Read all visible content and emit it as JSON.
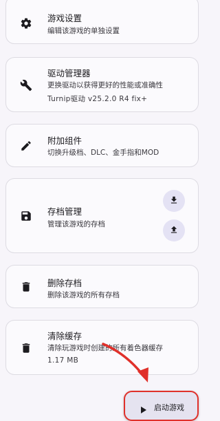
{
  "cards": {
    "game_settings": {
      "title": "游戏设置",
      "subtitle": "编辑该游戏的单独设置",
      "icon": "gear-icon"
    },
    "driver_manager": {
      "title": "驱动管理器",
      "subtitle": "更换驱动以获得更好的性能或准确性",
      "detail": "Turnip驱动 v25.2.0 R4 fix+",
      "icon": "wrench-icon"
    },
    "addons": {
      "title": "附加组件",
      "subtitle": "切换升级档、DLC、金手指和MOD",
      "icon": "pencil-icon"
    },
    "save_manager": {
      "title": "存档管理",
      "subtitle": "管理该游戏的存档",
      "icon": "floppy-disk-icon",
      "actions": [
        "download-icon",
        "upload-icon"
      ]
    },
    "delete_saves": {
      "title": "删除存档",
      "subtitle": "删除该游戏的所有存档",
      "icon": "trash-icon"
    },
    "clear_cache": {
      "title": "清除缓存",
      "subtitle": "清除玩游戏时创建的所有着色器缓存",
      "detail": "1.17 MB",
      "icon": "trash-icon"
    }
  },
  "fab": {
    "label": "启动游戏",
    "icon": "play-icon"
  },
  "colors": {
    "annotation_arrow": "#e0302a",
    "fab_background": "#e5e3f0",
    "circle_button": "#e4e2f4"
  }
}
